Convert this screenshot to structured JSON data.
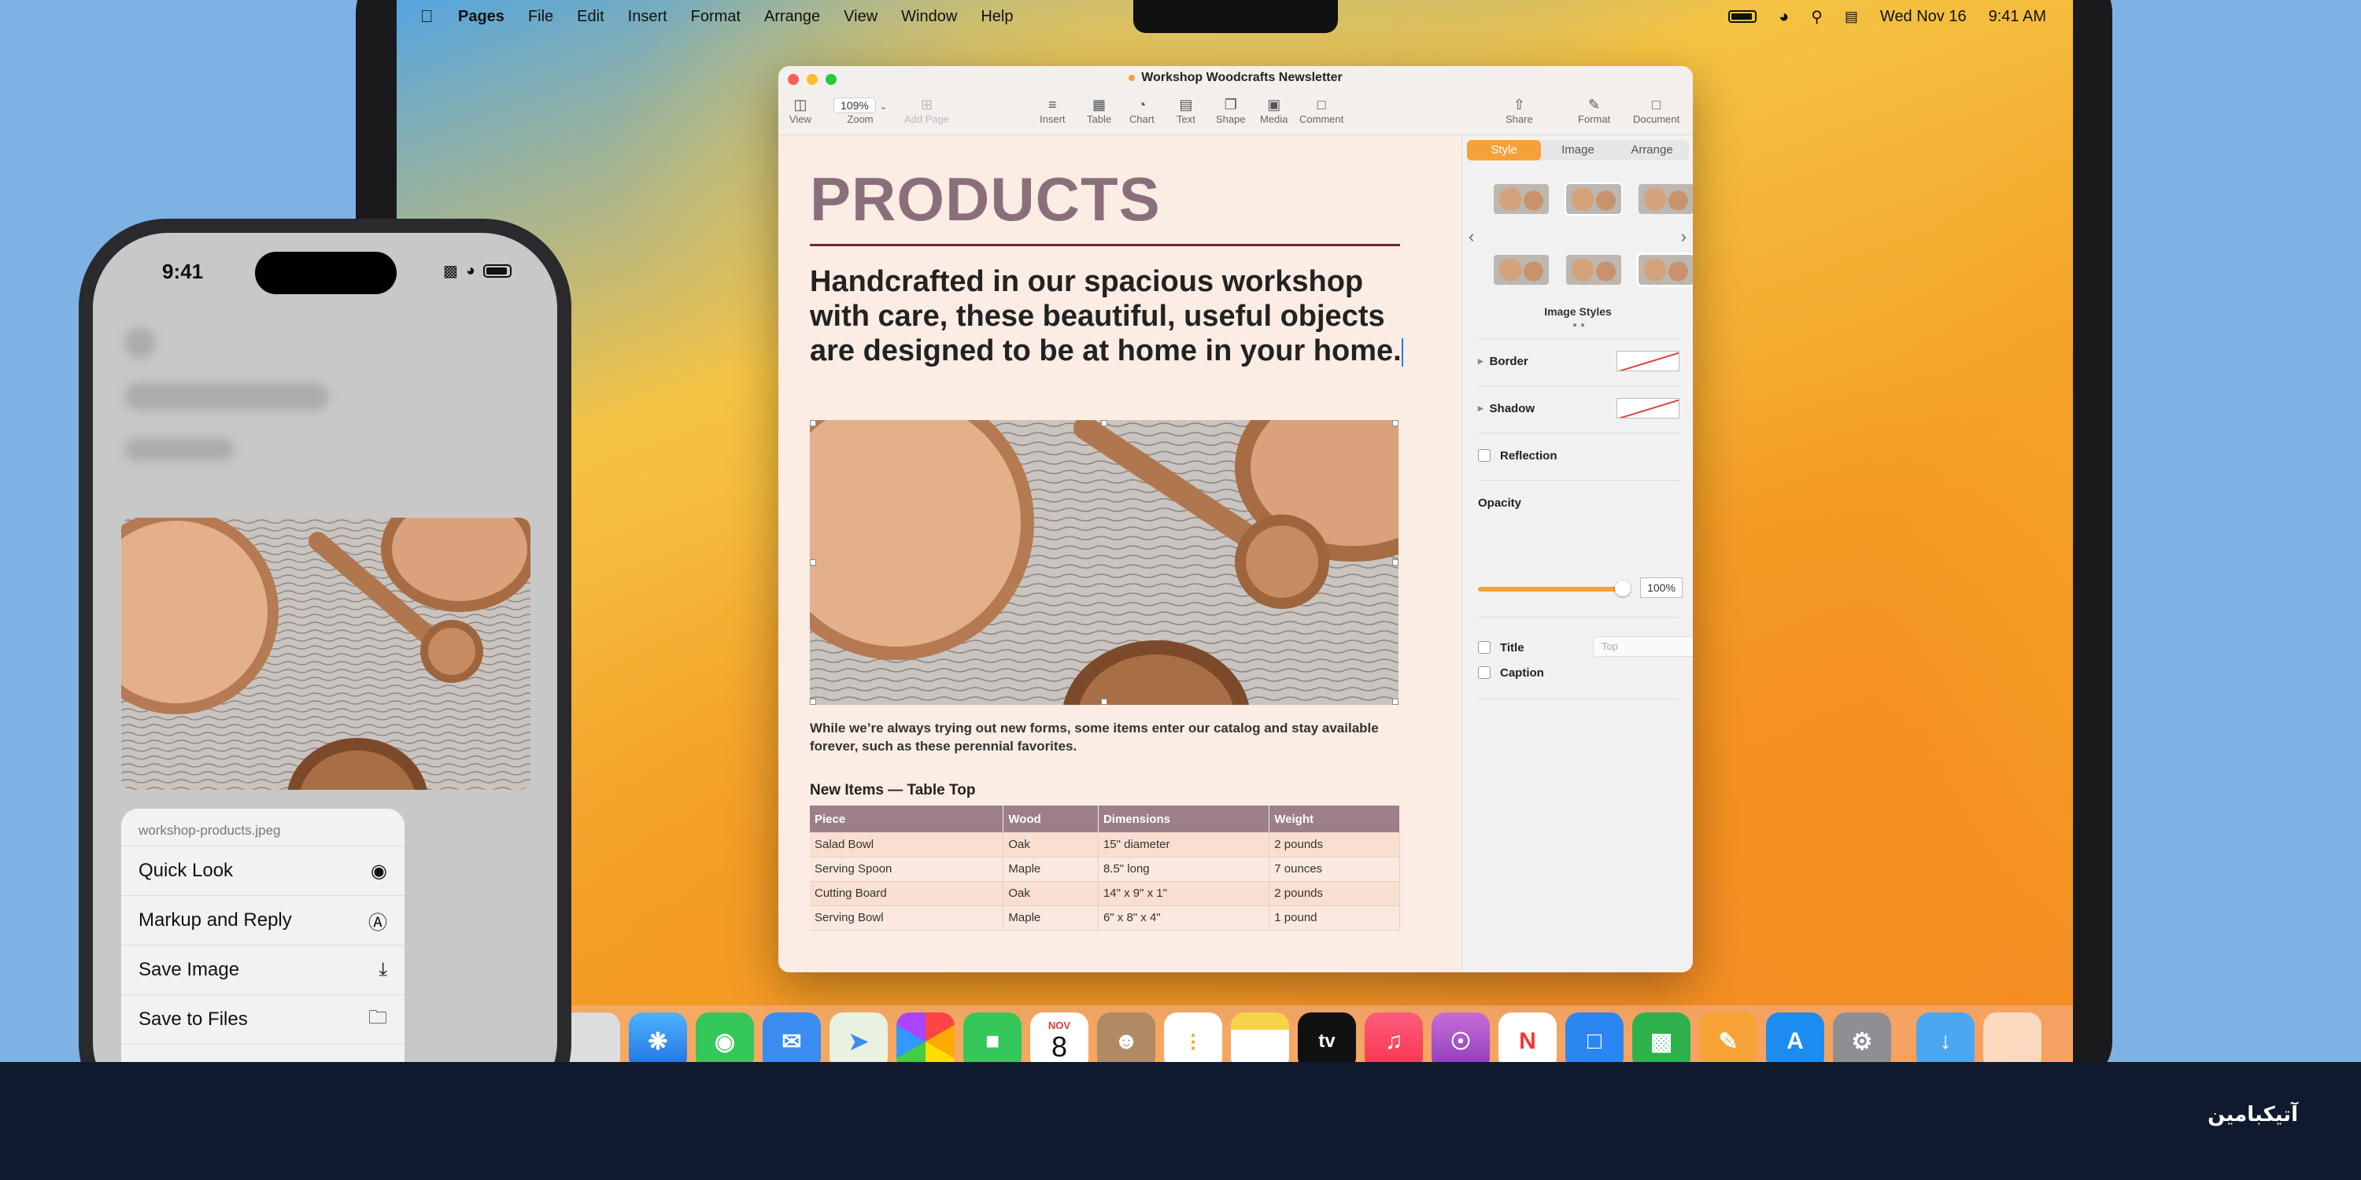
{
  "mac": {
    "menubar": {
      "app": "Pages",
      "items": [
        "File",
        "Edit",
        "Insert",
        "Format",
        "Arrange",
        "View",
        "Window",
        "Help"
      ],
      "date": "Wed Nov 16",
      "time": "9:41 AM"
    },
    "window": {
      "title": "Workshop Woodcrafts Newsletter",
      "toolbar": {
        "view": "View",
        "zoom_value": "109%",
        "zoom": "Zoom",
        "add_page": "Add Page",
        "insert": "Insert",
        "table": "Table",
        "chart": "Chart",
        "text": "Text",
        "shape": "Shape",
        "media": "Media",
        "comment": "Comment",
        "share": "Share",
        "format": "Format",
        "document": "Document"
      },
      "doc": {
        "heading": "PRODUCTS",
        "lead": "Handcrafted in our spacious workshop with care, these beautiful, useful objects are designed to be at home in your home.",
        "paragraph": "While we’re always trying out new forms, some items enter our catalog and stay available forever, such as these perennial favorites.",
        "table_title": "New Items — Table Top",
        "table": {
          "headers": [
            "Piece",
            "Wood",
            "Dimensions",
            "Weight"
          ],
          "rows": [
            [
              "Salad Bowl",
              "Oak",
              "15\" diameter",
              "2 pounds"
            ],
            [
              "Serving Spoon",
              "Maple",
              "8.5\" long",
              "7 ounces"
            ],
            [
              "Cutting Board",
              "Oak",
              "14\" x 9\" x 1\"",
              "2 pounds"
            ],
            [
              "Serving Bowl",
              "Maple",
              "6\" x 8\" x 4\"",
              "1 pound"
            ]
          ]
        }
      },
      "sidebar": {
        "tabs": [
          "Style",
          "Image",
          "Arrange"
        ],
        "image_styles_label": "Image Styles",
        "border": "Border",
        "shadow": "Shadow",
        "reflection": "Reflection",
        "opacity_label": "Opacity",
        "opacity_value": "100%",
        "opacity_fraction": 1.0,
        "title": "Title",
        "title_position": "Top",
        "caption": "Caption"
      }
    },
    "dock": {
      "calendar_month": "NOV",
      "calendar_day": "8",
      "tv_label": "tv"
    }
  },
  "phone": {
    "time": "9:41",
    "menu": {
      "filename": "workshop-products.jpeg",
      "items": [
        {
          "label": "Quick Look",
          "icon": "eye-icon"
        },
        {
          "label": "Markup and Reply",
          "icon": "markup-icon"
        },
        {
          "label": "Save Image",
          "icon": "save-image-icon"
        },
        {
          "label": "Save to Files",
          "icon": "folder-icon"
        }
      ]
    }
  },
  "brand": "آتیکبامین",
  "colors": {
    "accent": "#f5a13a",
    "table_header": "#9c7f89",
    "heading": "#8a6f7b",
    "band": "#0f1a2e"
  }
}
